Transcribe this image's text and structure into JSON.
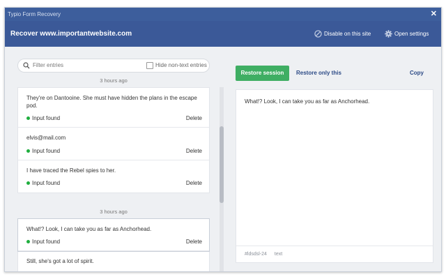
{
  "window": {
    "title": "Typio Form Recovery",
    "close_label": "✕"
  },
  "header": {
    "title": "Recover www.importantwebsite.com",
    "disable_label": "Disable on this site",
    "settings_label": "Open settings"
  },
  "filter": {
    "placeholder": "Filter entries",
    "hide_label": "Hide non-text entries",
    "hide_checked": false
  },
  "groups": [
    {
      "time": "3 hours ago",
      "entries": [
        {
          "text": "They're on Dantooine. She must have hidden the plans in the escape pod.",
          "status": "Input found",
          "delete": "Delete"
        },
        {
          "text": "elvis@mail.com",
          "status": "Input found",
          "delete": "Delete"
        },
        {
          "text": "I have traced the Rebel spies to her.",
          "status": "Input found",
          "delete": "Delete"
        }
      ]
    },
    {
      "time": "3 hours ago",
      "entries": [
        {
          "text": "What!? Look, I can take you as far as Anchorhead.",
          "status": "Input found",
          "delete": "Delete"
        },
        {
          "text": "Still, she's got a lot of spirit.",
          "status": "",
          "delete": ""
        }
      ]
    }
  ],
  "actions": {
    "restore_session": "Restore session",
    "restore_only": "Restore only this",
    "copy": "Copy"
  },
  "preview": {
    "text": "What!? Look, I can take you as far as Anchorhead.",
    "field_id": "#ldsdsl-24",
    "field_type": "text"
  },
  "colors": {
    "header": "#3b5998",
    "titlebar": "#3d5e9c",
    "accent_green": "#3fae63",
    "found_dot": "#1fae3e",
    "link": "#2c4a86"
  }
}
